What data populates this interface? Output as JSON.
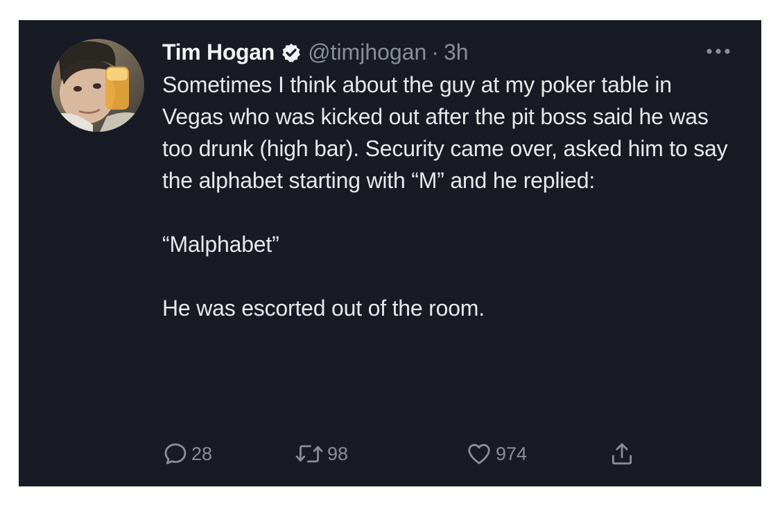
{
  "tweet": {
    "author": {
      "display_name": "Tim Hogan",
      "handle": "@timjhogan",
      "separator": "·",
      "time": "3h",
      "verified": true
    },
    "body_paragraphs": [
      "Sometimes I think about the guy at my poker table in Vegas who was kicked out after the pit boss said he was too drunk (high bar). Security came over, asked him to say the alphabet starting with “M” and he replied:",
      "“Malphabet”",
      "He was escorted out of the room."
    ],
    "actions": {
      "reply_count": "28",
      "retweet_count": "98",
      "like_count": "974"
    }
  },
  "icons": {
    "verified": "verified-badge-icon",
    "more": "more-options-icon",
    "reply": "speech-bubble-icon",
    "retweet": "retweet-arrows-icon",
    "like": "heart-icon",
    "share": "share-upload-icon"
  },
  "colors": {
    "card_background": "#181b24",
    "primary_text": "#e8e9ea",
    "secondary_text": "#8a8f96"
  }
}
